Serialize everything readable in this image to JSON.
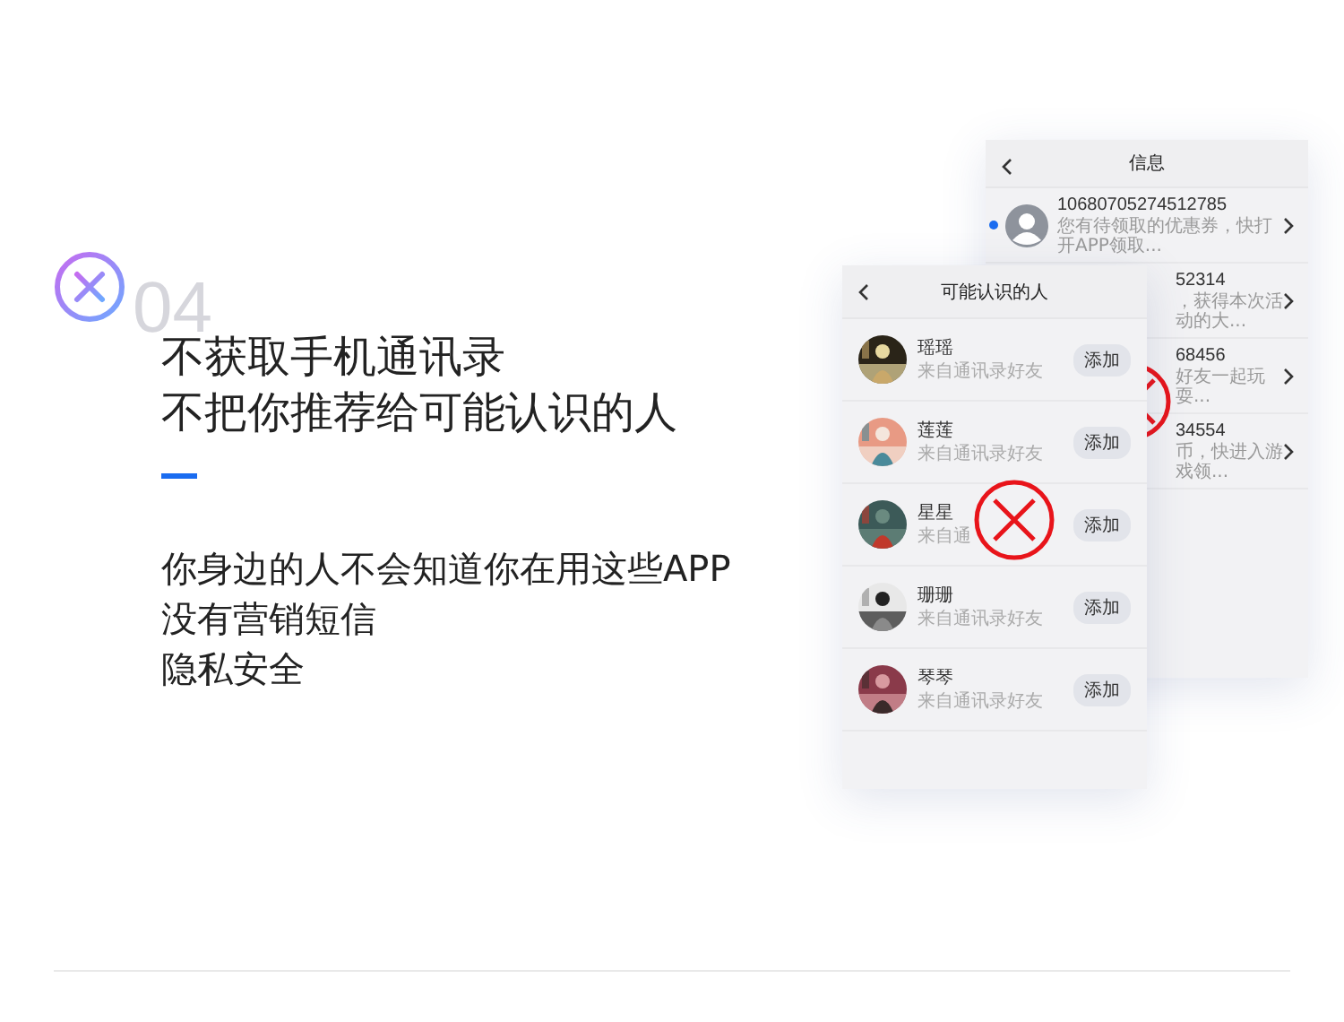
{
  "slide_number": "04",
  "headline": [
    "不获取手机通讯录",
    "不把你推荐给可能认识的人"
  ],
  "body": [
    "你身边的人不会知道你在用这些APP",
    "没有营销短信",
    "隐私安全"
  ],
  "back_screen": {
    "title": "信息",
    "messages": [
      {
        "sender": "10680705274512785",
        "preview": "您有待领取的优惠券，快打开APP领取...",
        "unread": true,
        "avatar": true
      },
      {
        "sender": "52314",
        "preview": "，获得本次活动的大...",
        "avatar": false
      },
      {
        "sender": "68456",
        "preview": "好友一起玩耍...",
        "avatar": false
      },
      {
        "sender": "34554",
        "preview": "币，快进入游戏领...",
        "avatar": false
      }
    ]
  },
  "front_screen": {
    "title": "可能认识的人",
    "contacts": [
      {
        "name": "瑶瑶",
        "note": "来自通讯录好友",
        "button": "添加"
      },
      {
        "name": "莲莲",
        "note": "来自通讯录好友",
        "button": "添加"
      },
      {
        "name": "星星",
        "note": "来自通",
        "button": "添加"
      },
      {
        "name": "珊珊",
        "note": "来自通讯录好友",
        "button": "添加"
      },
      {
        "name": "琴琴",
        "note": "来自通讯录好友",
        "button": "添加"
      }
    ]
  }
}
